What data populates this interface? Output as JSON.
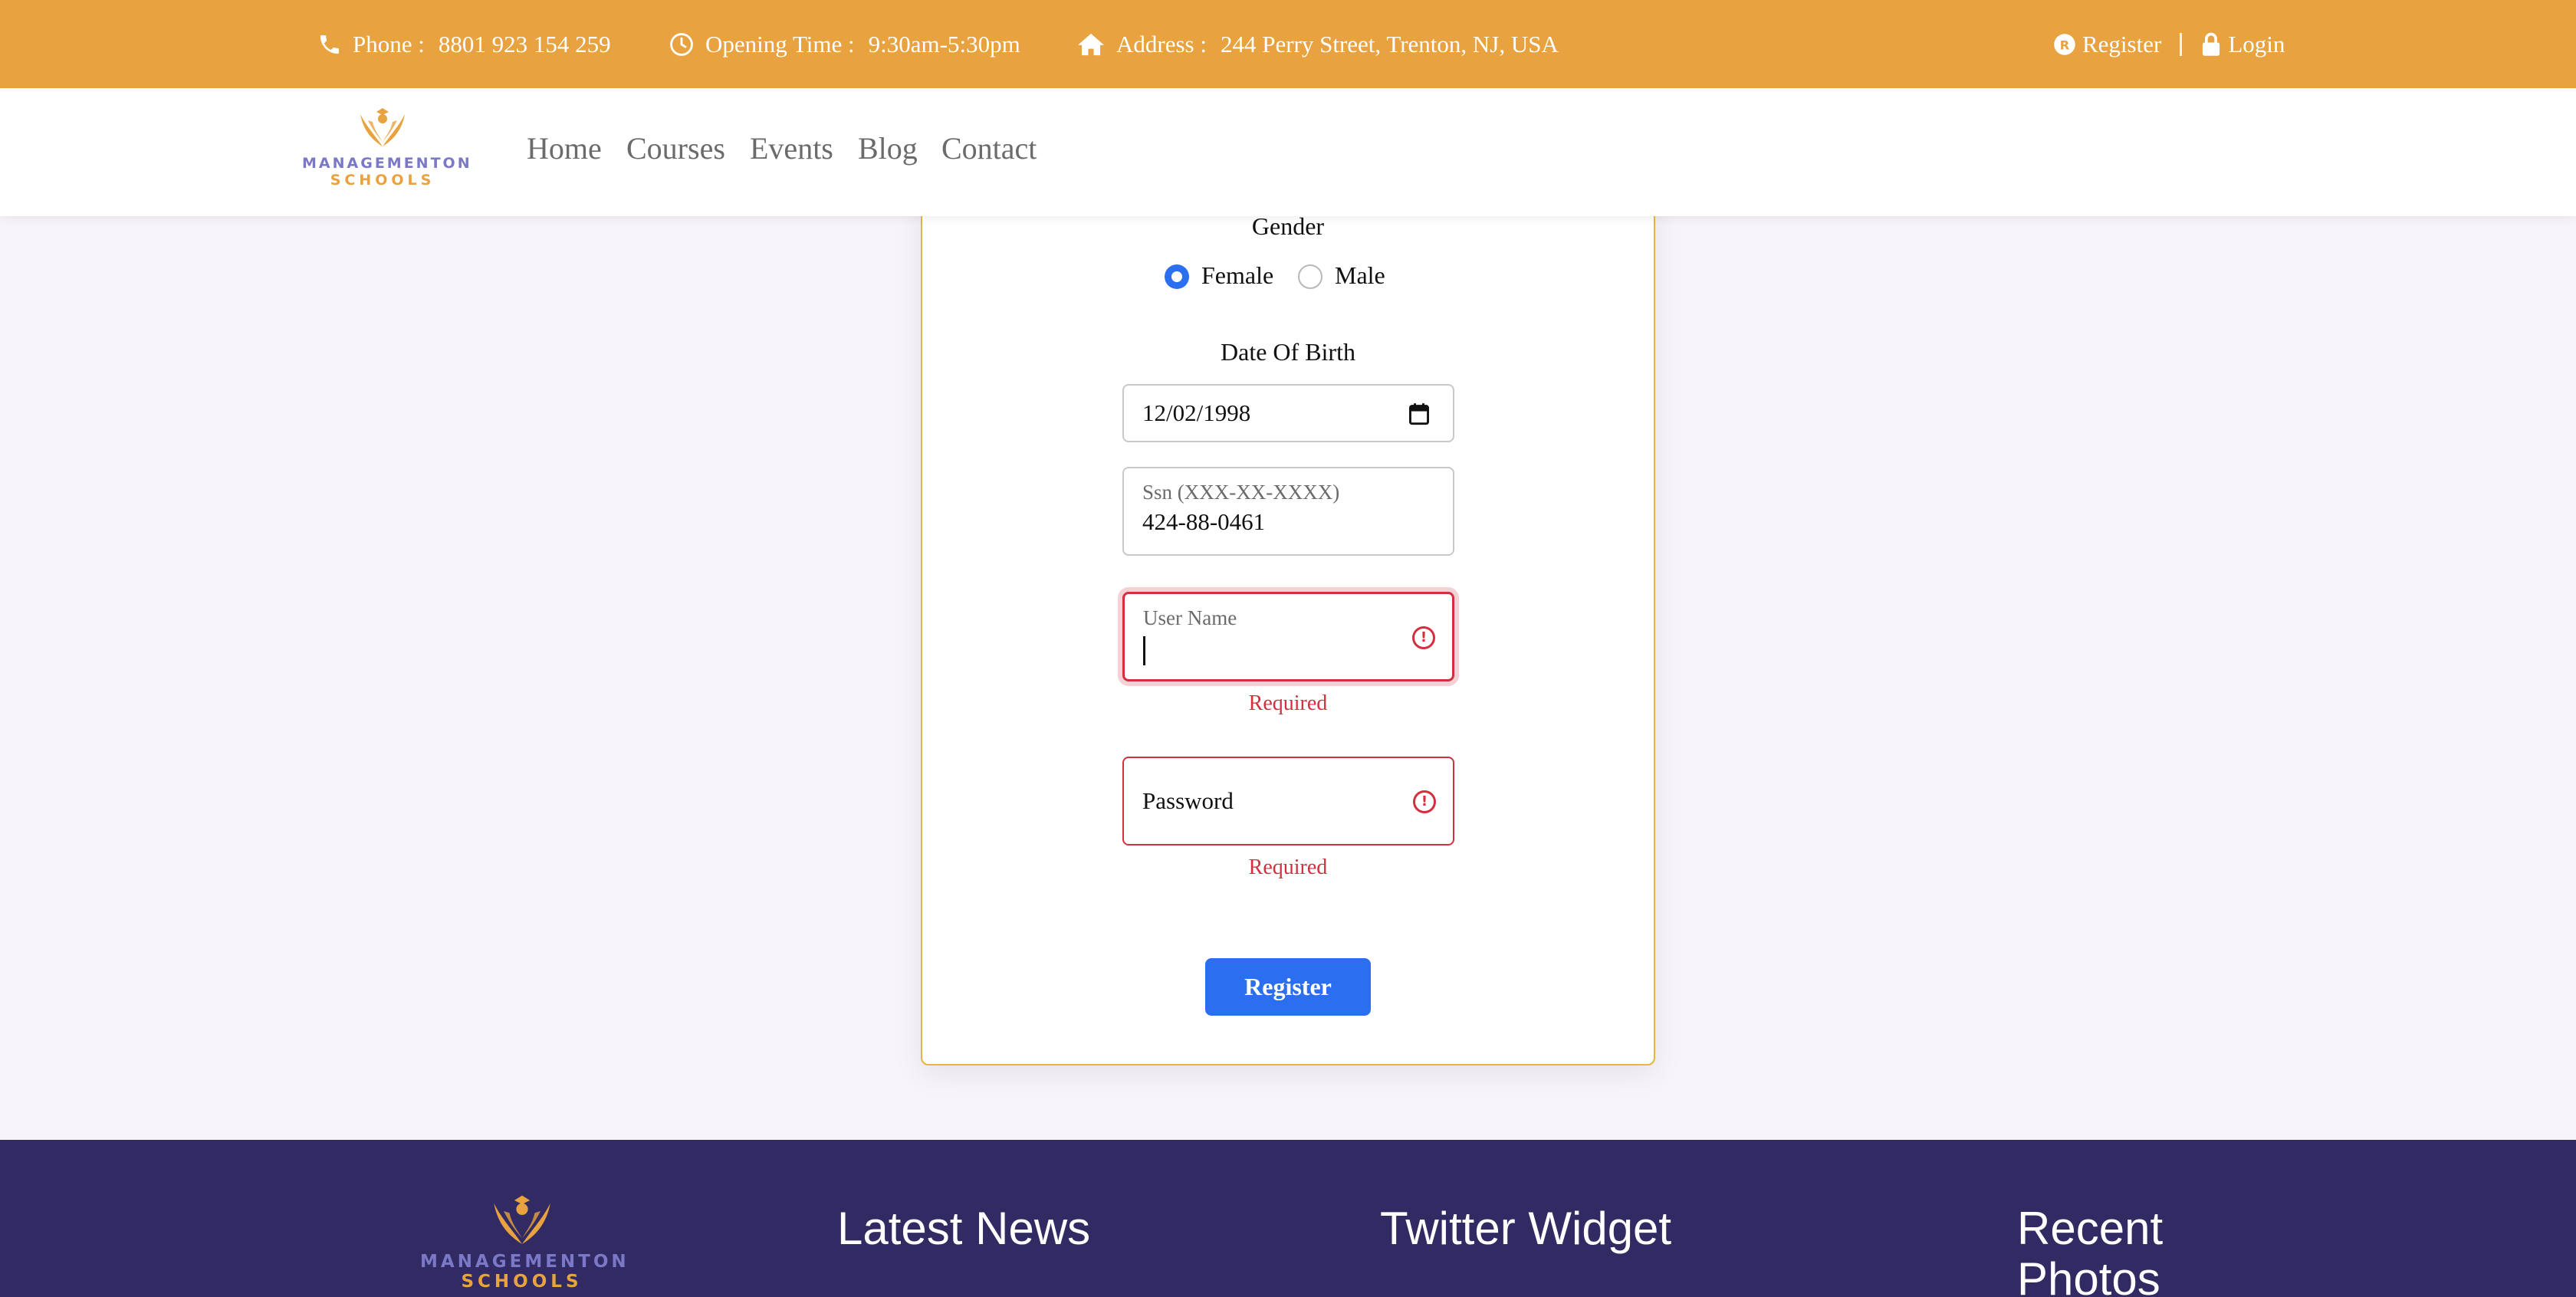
{
  "topbar": {
    "phone_label": "Phone :",
    "phone_value": "8801 923 154 259",
    "opening_label": "Opening Time :",
    "opening_value": "9:30am-5:30pm",
    "address_label": "Address :",
    "address_value": "244 Perry Street, Trenton, NJ, USA",
    "register_label": "Register",
    "login_label": "Login",
    "icons": [
      "phone-icon",
      "clock-icon",
      "home-icon",
      "register-icon",
      "lock-icon"
    ],
    "background_color": "#e8a23f"
  },
  "brand": {
    "line1": "MANAGEMENTON",
    "line2": "SCHOOLS"
  },
  "nav": {
    "items": [
      "Home",
      "Courses",
      "Events",
      "Blog",
      "Contact"
    ]
  },
  "form": {
    "gender_label": "Gender",
    "gender_options": [
      "Female",
      "Male"
    ],
    "gender_selected": "Female",
    "dob_label": "Date Of Birth",
    "dob_value": "12/02/1998",
    "ssn_label": "Ssn (XXX-XX-XXXX)",
    "ssn_value": "424-88-0461",
    "username_label": "User Name",
    "username_value": "",
    "username_error": "Required",
    "password_placeholder": "Password",
    "password_error": "Required",
    "submit_label": "Register",
    "accent_color": "#2b6ff0",
    "error_color": "#d32f3f"
  },
  "footer": {
    "headings": [
      "Latest News",
      "Twitter Widget",
      "Recent Photos"
    ],
    "background_color": "#312a63"
  }
}
